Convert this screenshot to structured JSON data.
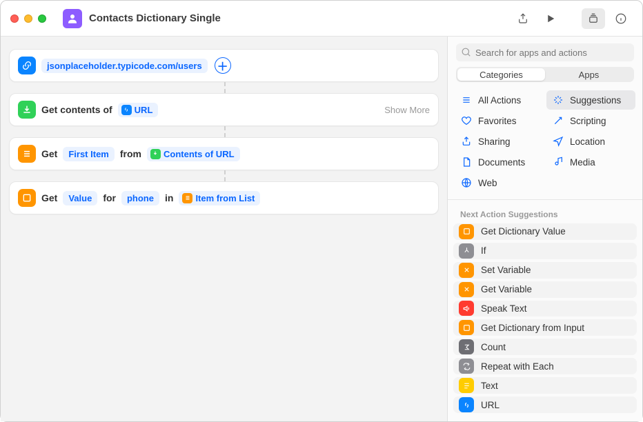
{
  "window": {
    "title": "Contacts Dictionary Single"
  },
  "canvas": {
    "url_token": "jsonplaceholder.typicode.com/users",
    "card2_prefix": "Get contents of",
    "card2_token": "URL",
    "card2_more": "Show More",
    "card3_prefix": "Get",
    "card3_token1": "First Item",
    "card3_mid": "from",
    "card3_token2": "Contents of URL",
    "card4_prefix": "Get",
    "card4_token1": "Value",
    "card4_mid1": "for",
    "card4_token2": "phone",
    "card4_mid2": "in",
    "card4_token3": "Item from List"
  },
  "inspector": {
    "search_placeholder": "Search for apps and actions",
    "seg": {
      "a": "Categories",
      "b": "Apps"
    },
    "cats": {
      "all": "All Actions",
      "suggestions": "Suggestions",
      "favorites": "Favorites",
      "scripting": "Scripting",
      "sharing": "Sharing",
      "location": "Location",
      "documents": "Documents",
      "media": "Media",
      "web": "Web"
    },
    "sugg_head": "Next Action Suggestions",
    "sugg": {
      "a": "Get Dictionary Value",
      "b": "If",
      "c": "Set Variable",
      "d": "Get Variable",
      "e": "Speak Text",
      "f": "Get Dictionary from Input",
      "g": "Count",
      "h": "Repeat with Each",
      "i": "Text",
      "j": "URL"
    }
  }
}
